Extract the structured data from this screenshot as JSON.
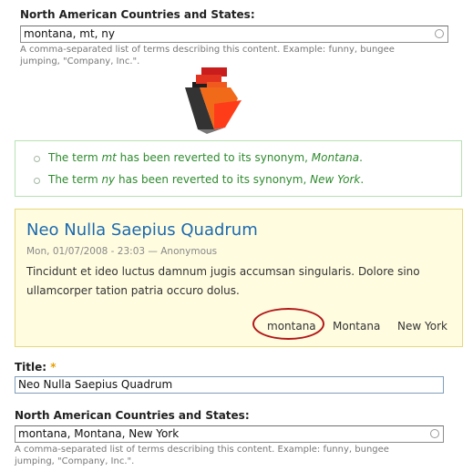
{
  "top_field": {
    "label": "North American Countries and States:",
    "value": "montana, mt, ny",
    "description_line1": "A comma-separated list of terms describing this content. Example: funny, bungee",
    "description_line2": "jumping, \"Company, Inc.\"."
  },
  "status": {
    "items": [
      {
        "pre": "The term ",
        "term": "mt",
        "mid": " has been reverted to its synonym, ",
        "synonym": "Montana",
        "post": "."
      },
      {
        "pre": "The term ",
        "term": "ny",
        "mid": " has been reverted to its synonym, ",
        "synonym": "New York",
        "post": "."
      }
    ]
  },
  "node": {
    "title": "Neo Nulla Saepius Quadrum",
    "meta": "Mon, 01/07/2008 - 23:03 — Anonymous",
    "body": "Tincidunt et ideo luctus damnum jugis accumsan singularis. Dolore sino ullamcorper tation patria occuro dolus.",
    "tags": [
      "montana",
      "Montana",
      "New York"
    ]
  },
  "title_field": {
    "label": "Title:",
    "required_marker": "*",
    "value": "Neo Nulla Saepius Quadrum"
  },
  "bottom_field": {
    "label": "North American Countries and States:",
    "value": "montana, Montana, New York",
    "description_line1": "A comma-separated list of terms describing this content. Example: funny, bungee",
    "description_line2": "jumping, \"Company, Inc.\"."
  },
  "colors": {
    "status_text": "#2d8a2d",
    "status_border": "#b7e2b3",
    "node_background": "#fffce0",
    "node_border": "#e6d77f",
    "title_link": "#1b6ab0",
    "annotation_circle": "#b21818",
    "required_marker": "#e6a000"
  },
  "icons": {
    "logo": "red-3d-arrow-logo",
    "throbber": "autocomplete-throbber-icon"
  }
}
